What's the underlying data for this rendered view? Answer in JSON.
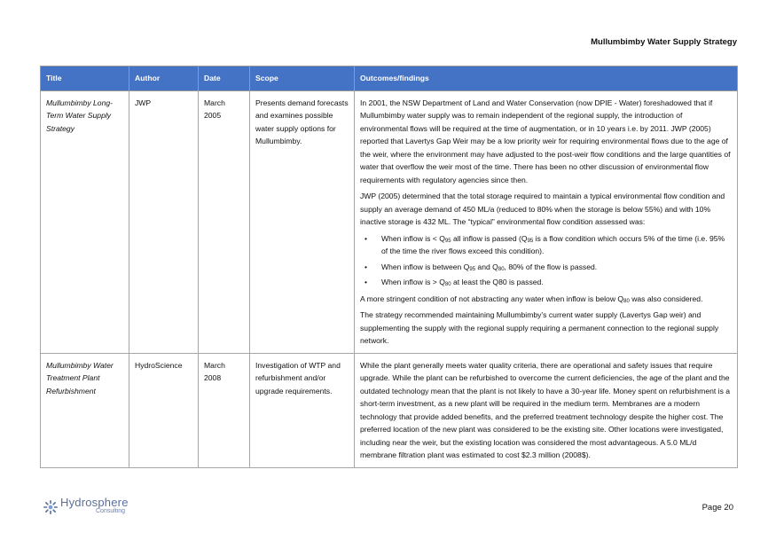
{
  "header": {
    "title": "Mullumbimby Water Supply Strategy"
  },
  "table": {
    "columns": [
      "Title",
      "Author",
      "Date",
      "Scope",
      "Outcomes/findings"
    ],
    "rows": [
      {
        "title": "Mullumbimby Long-Term Water Supply Strategy",
        "author": "JWP",
        "date": "March 2005",
        "scope": "Presents demand forecasts and examines possible water supply options for Mullumbimby.",
        "p1": "In 2001, the NSW Department of Land and Water Conservation (now DPIE - Water) foreshadowed that if Mullumbimby water supply was to remain independent of the regional supply, the introduction of environmental flows will be required at the time of augmentation, or in 10 years i.e. by 2011. JWP (2005) reported that Lavertys Gap Weir may be a low priority weir for requiring environmental flows due to the age of the weir, where the environment may have adjusted to the post-weir flow conditions and the large quantities of water that overflow the weir most of the time. There has been no other discussion of environmental flow requirements with regulatory agencies since then.",
        "p2": "JWP (2005) determined that the total storage required to maintain a typical environmental flow condition and supply an average demand of 450 ML/a (reduced to 80% when the storage is below 55%) and with 10% inactive storage is 432 ML. The “typical” environmental flow condition assessed was:",
        "bullet1": {
          "a": "When inflow is < Q",
          "s1": "95",
          "b": " all inflow is passed (Q",
          "s2": "95",
          "c": " is a flow condition which occurs 5% of the time (i.e. 95% of the time the river flows exceed this condition)."
        },
        "bullet2": {
          "a": "When inflow is between Q",
          "s1": "95",
          "b": " and Q",
          "s2": "80",
          "c": ", 80% of the flow is passed."
        },
        "bullet3": {
          "a": "When inflow is > Q",
          "s1": "80",
          "b": " at least the Q80 is passed."
        },
        "p3": {
          "a": "A more stringent condition of not abstracting any water when inflow is below Q",
          "s1": "80",
          "b": " was also considered."
        },
        "p4": "The strategy recommended maintaining Mullumbimby’s current water supply (Lavertys Gap weir) and supplementing the supply with the regional supply requiring a permanent connection to the regional supply network."
      },
      {
        "title": "Mullumbimby Water Treatment Plant Refurbishment",
        "author": "HydroScience",
        "date": "March 2008",
        "scope": "Investigation of WTP and refurbishment and/or upgrade requirements.",
        "p1": "While the plant generally meets water quality criteria, there are operational and safety issues that require upgrade. While the plant can be refurbished to overcome the current deficiencies, the age of the plant and the outdated technology mean that the plant is not likely to have a 30-year life. Money spent on refurbishment is a short-term investment, as a new plant will be required in the medium term. Membranes are a modern technology that provide added benefits, and the preferred treatment technology despite the higher cost. The preferred location of the new plant was considered to be the existing site. Other locations were investigated, including near the weir, but the existing location was considered the most advantageous. A 5.0 ML/d membrane filtration plant was estimated to cost $2.3 million (2008$)."
      }
    ]
  },
  "footer": {
    "logo_main": "Hydrosphere",
    "logo_sub": "Consulting",
    "page": "Page 20"
  },
  "colors": {
    "header_fill": "#4472c4",
    "logo_blue": "#5a6f9a"
  },
  "icons": {
    "logo": "hydrosphere-sun-logo-icon",
    "bullet": "bullet-dot-icon"
  }
}
